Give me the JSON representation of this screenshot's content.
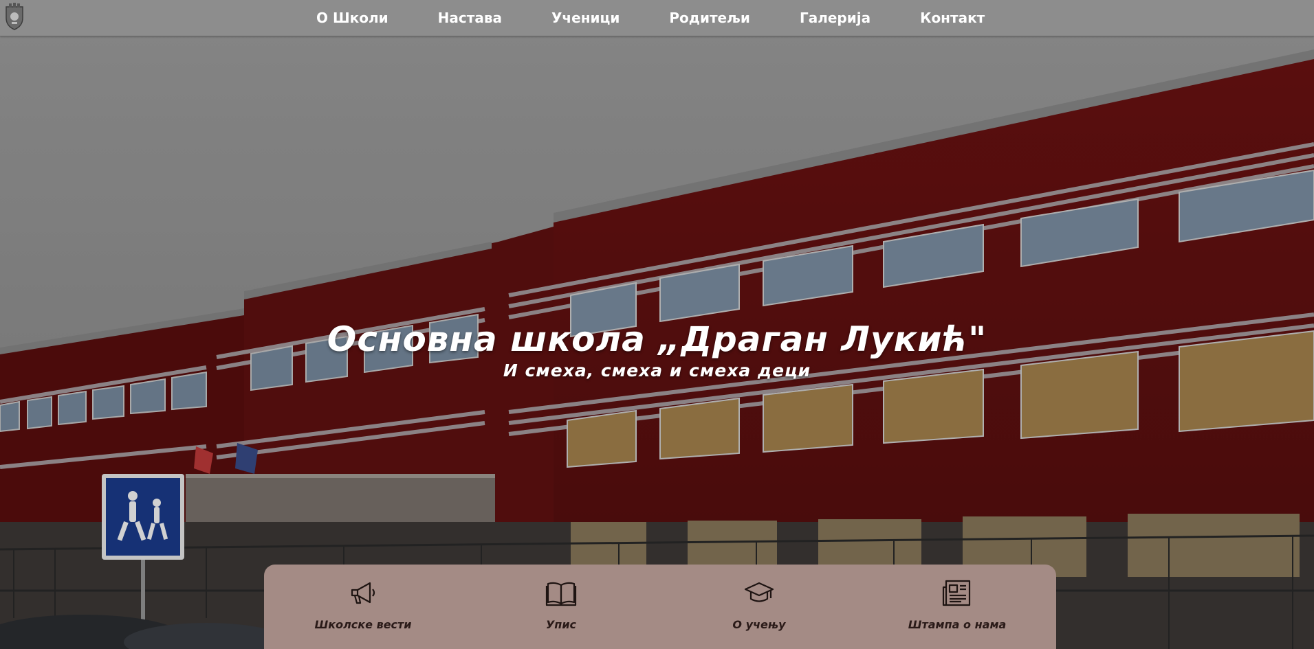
{
  "nav": {
    "items": [
      {
        "label": "О Школи"
      },
      {
        "label": "Настава"
      },
      {
        "label": "Ученици"
      },
      {
        "label": "Родитељи"
      },
      {
        "label": "Галерија"
      },
      {
        "label": "Контакт"
      }
    ]
  },
  "hero": {
    "title": "Основна школа „Драган Лукић\"",
    "subtitle": "И смеха, смеха и смеха деци"
  },
  "quick_links": [
    {
      "label": "Школске вести",
      "icon": "megaphone-icon"
    },
    {
      "label": "Упис",
      "icon": "open-book-icon"
    },
    {
      "label": "О учењу",
      "icon": "graduation-cap-icon"
    },
    {
      "label": "Штампа о нама",
      "icon": "newspaper-icon"
    }
  ],
  "colors": {
    "quick_links_bg": "#a48b85",
    "nav_text": "#ffffff",
    "building_red": "#7a1414"
  }
}
